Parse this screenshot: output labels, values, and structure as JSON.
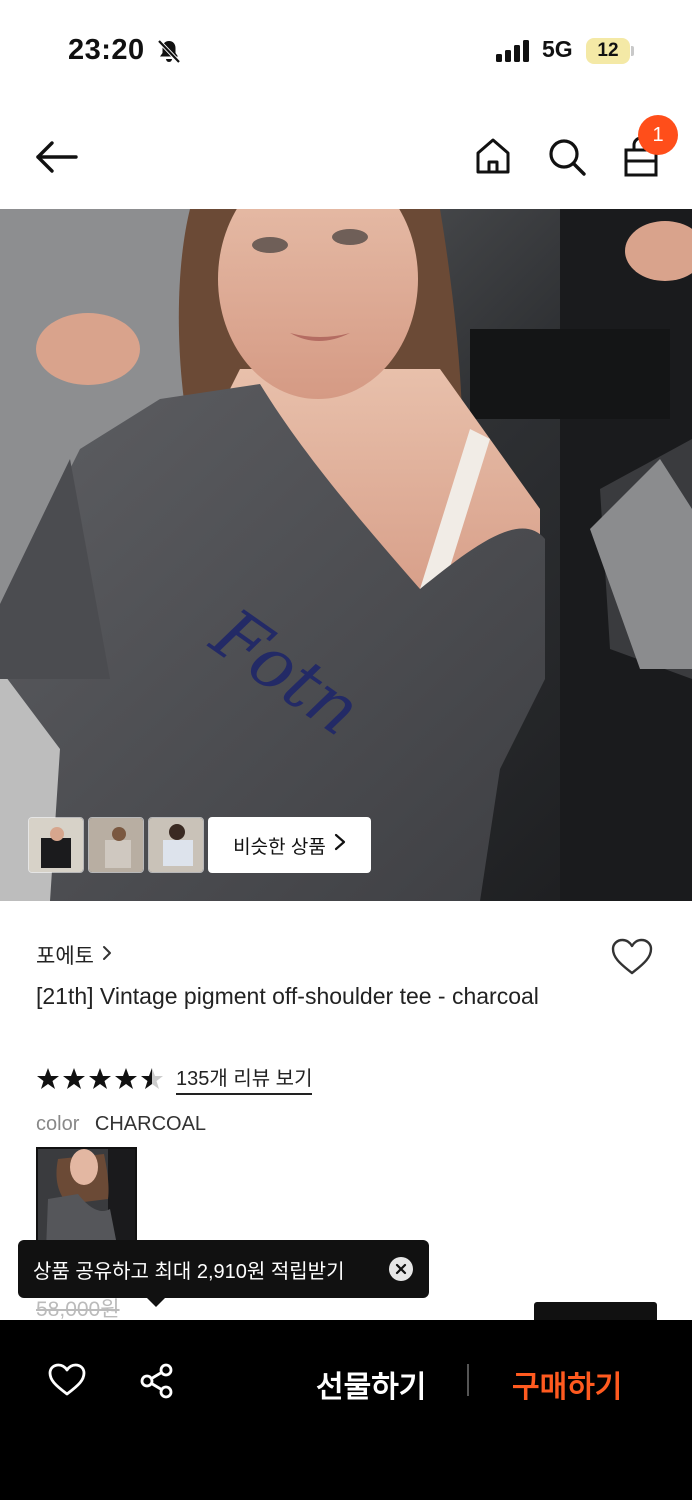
{
  "status_bar": {
    "time": "23:20",
    "network": "5G",
    "battery": "12",
    "icons": [
      "bell-muted-icon",
      "signal-icon",
      "battery-icon"
    ]
  },
  "header": {
    "icons": [
      "back-arrow-icon",
      "home-icon",
      "search-icon",
      "shopping-bag-icon"
    ],
    "cart_count": "1"
  },
  "gallery": {
    "similar_label": "비슷한 상품",
    "thumb_count": 3
  },
  "product": {
    "brand": "포에토",
    "title": "[21th] Vintage pigment off-shoulder tee - charcoal",
    "rating": 4.5,
    "review_link": "135개 리뷰 보기",
    "color_label": "color",
    "color_value": "CHARCOAL",
    "original_price": "58,000원"
  },
  "tooltip": {
    "text": "상품 공유하고 최대 2,910원 적립받기"
  },
  "bottom_bar": {
    "gift_label": "선물하기",
    "buy_label": "구매하기",
    "icons": [
      "heart-outline-icon",
      "share-icon"
    ]
  },
  "colors": {
    "accent": "#ff5a1f",
    "badge": "#ff4e1a",
    "battery_fill": "#f4e9a6",
    "bottom_bar": "#000000"
  }
}
